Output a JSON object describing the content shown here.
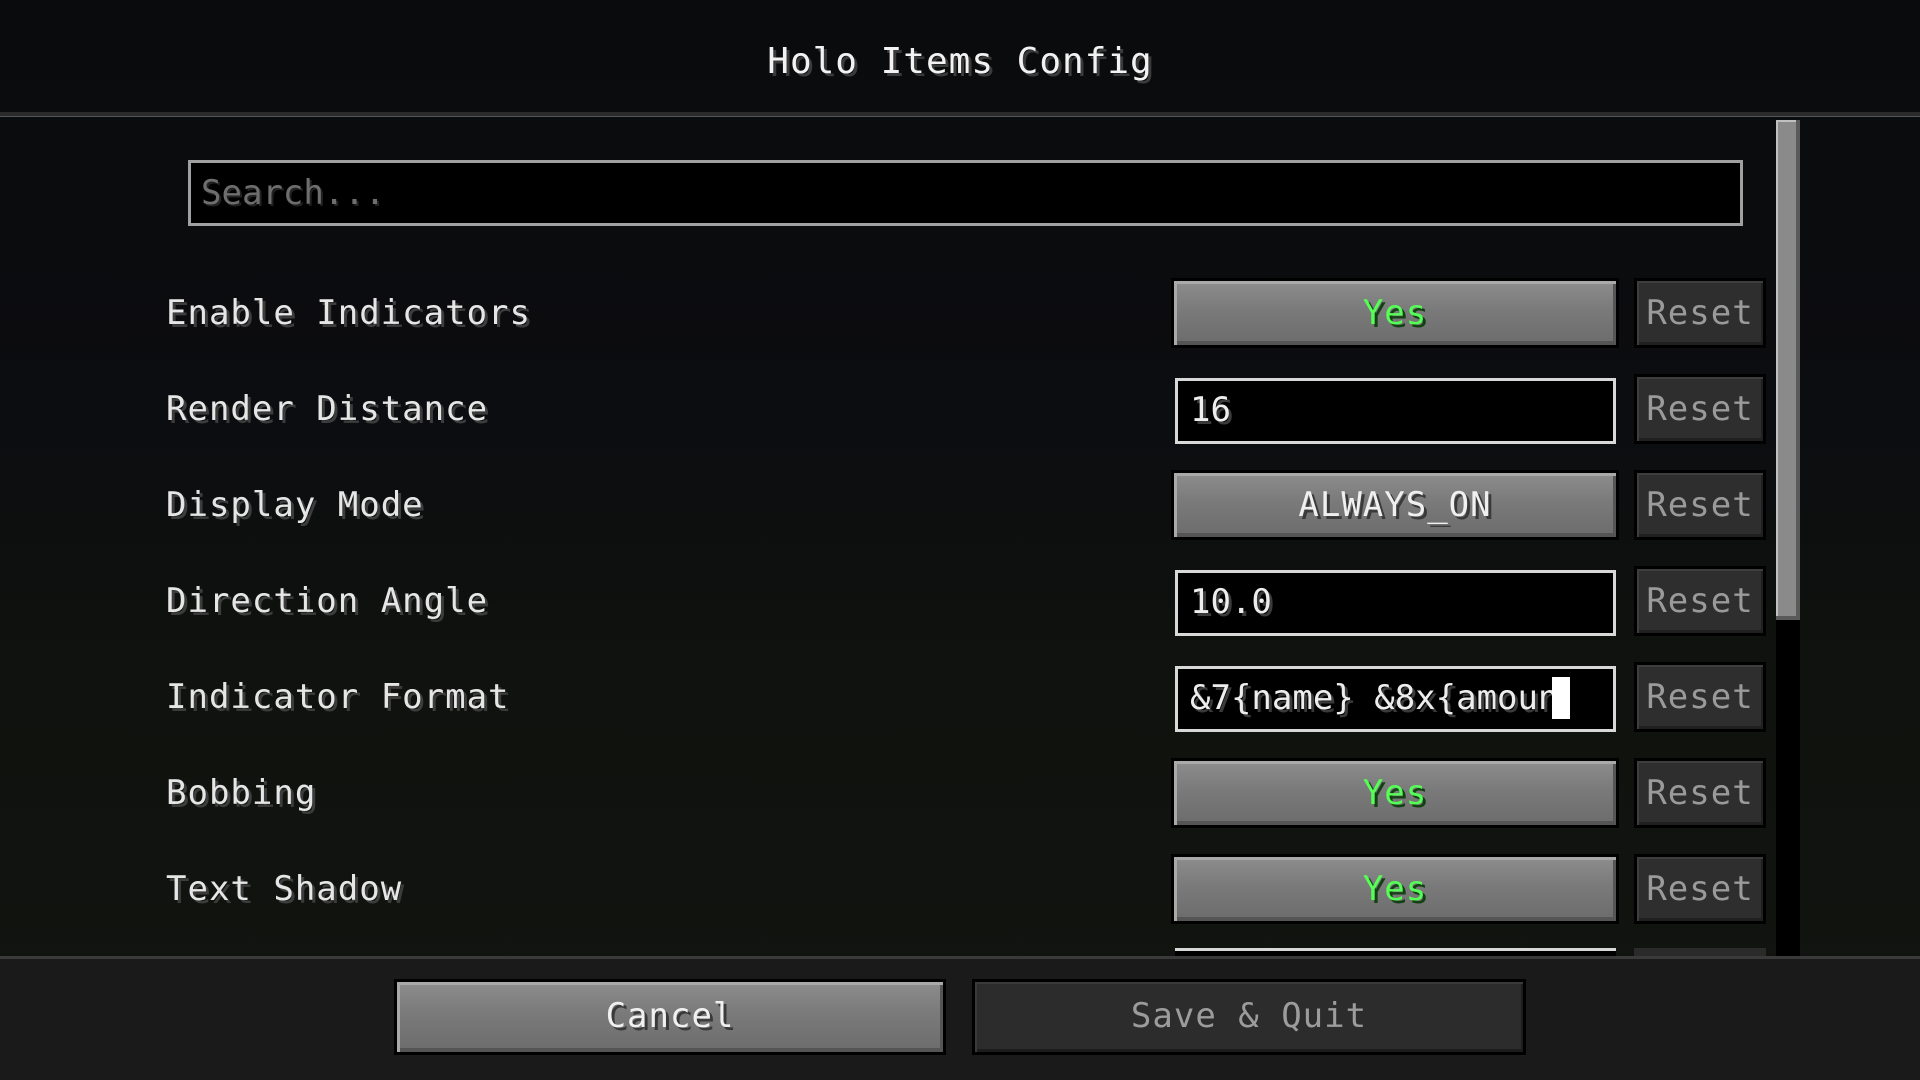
{
  "window": {
    "title": "Holo Items Config"
  },
  "search": {
    "placeholder": "Search...",
    "value": ""
  },
  "options": [
    {
      "label": "Enable Indicators",
      "type": "toggle",
      "value": "Yes",
      "reset_label": "Reset"
    },
    {
      "label": "Render Distance",
      "type": "text",
      "value": "16",
      "reset_label": "Reset"
    },
    {
      "label": "Display Mode",
      "type": "cycle",
      "value": "ALWAYS_ON",
      "reset_label": "Reset"
    },
    {
      "label": "Direction Angle",
      "type": "text",
      "value": "10.0",
      "reset_label": "Reset"
    },
    {
      "label": "Indicator Format",
      "type": "text",
      "value": "&7{name} &8x{amoun",
      "reset_label": "Reset"
    },
    {
      "label": "Bobbing",
      "type": "toggle",
      "value": "Yes",
      "reset_label": "Reset"
    },
    {
      "label": "Text Shadow",
      "type": "toggle",
      "value": "Yes",
      "reset_label": "Reset"
    }
  ],
  "footer": {
    "cancel_label": "Cancel",
    "save_label": "Save & Quit"
  },
  "colors": {
    "toggle_yes": "#55ff55",
    "button_gray": "#7a7a7a",
    "disabled_text": "#9a9a9a"
  }
}
